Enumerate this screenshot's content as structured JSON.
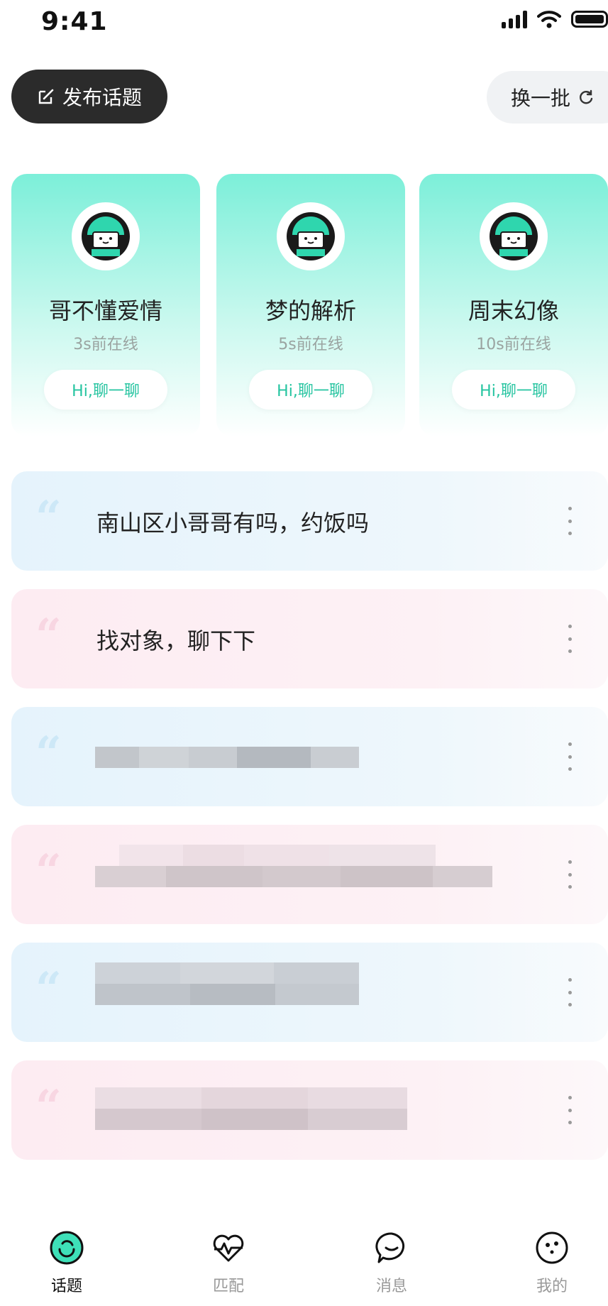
{
  "status_bar": {
    "time": "9:41"
  },
  "header": {
    "publish_label": "发布话题",
    "refresh_label": "换一批"
  },
  "cards": [
    {
      "name": "哥不懂爱情",
      "online": "3s前在线",
      "chat_label": "Hi,聊一聊"
    },
    {
      "name": "梦的解析",
      "online": "5s前在线",
      "chat_label": "Hi,聊一聊"
    },
    {
      "name": "周末幻像",
      "online": "10s前在线",
      "chat_label": "Hi,聊一聊"
    }
  ],
  "topics": [
    {
      "text": "南山区小哥哥有吗，约饭吗",
      "theme": "blue"
    },
    {
      "text": "找对象，聊下下",
      "theme": "pink"
    },
    {
      "text": "",
      "theme": "blue",
      "blurred": true
    },
    {
      "text": "",
      "theme": "pink",
      "blurred": true
    },
    {
      "text": "",
      "theme": "blue",
      "blurred": true
    },
    {
      "text": "",
      "theme": "pink",
      "blurred": true
    }
  ],
  "tab_bar": {
    "tabs": [
      {
        "label": "话题",
        "icon": "topic-icon",
        "active": true
      },
      {
        "label": "匹配",
        "icon": "heart-pulse-icon",
        "active": false
      },
      {
        "label": "消息",
        "icon": "chat-bubble-icon",
        "active": false
      },
      {
        "label": "我的",
        "icon": "profile-face-icon",
        "active": false
      }
    ]
  },
  "colors": {
    "accent": "#25c4a0",
    "card_gradient_top": "#7cefd9",
    "topic_blue": "#e5f3fc",
    "topic_pink": "#fdecf2",
    "publish_button": "#2b2b2b"
  }
}
